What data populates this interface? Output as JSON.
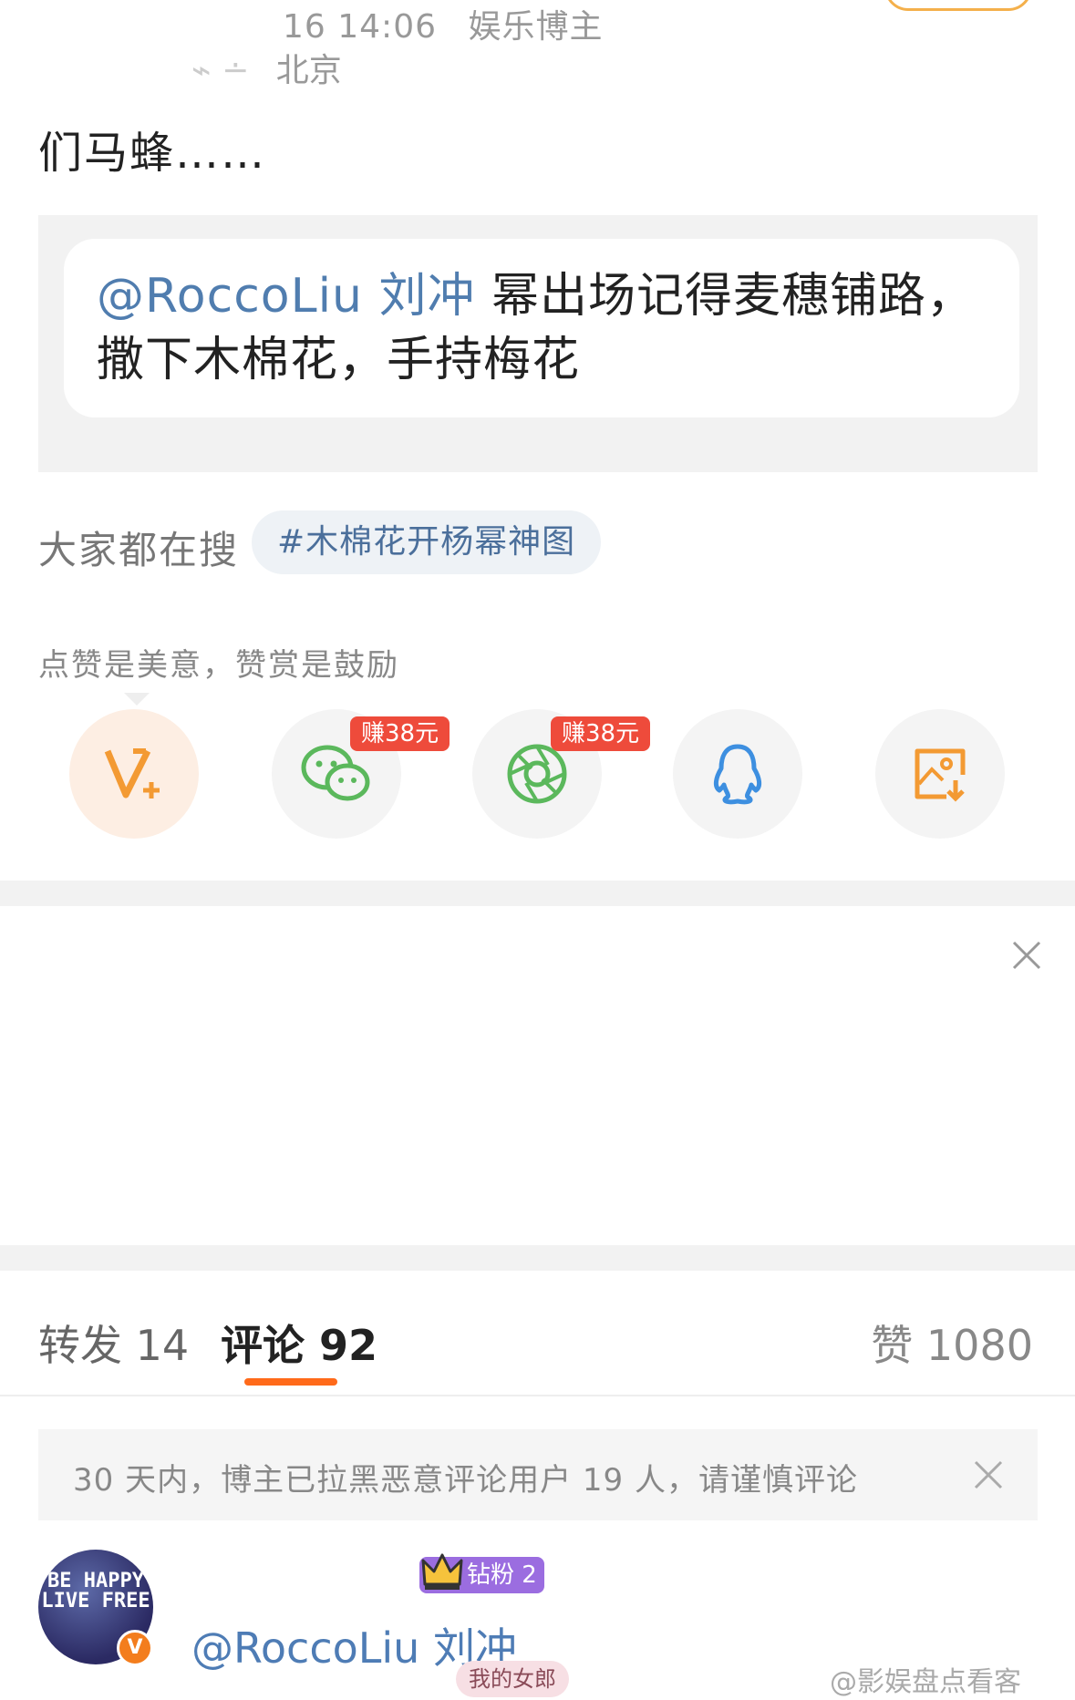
{
  "post": {
    "time": "16 14:06",
    "source": "娱乐博主",
    "location": "北京",
    "text": "们马蜂……"
  },
  "quote": {
    "mention": "@RoccoLiu 刘冲",
    "text_line1": " 幂出场记得麦穗铺路，",
    "text_line2": "撒下木棉花，手持梅花"
  },
  "search": {
    "label": "大家都在搜",
    "tag": "#木棉花开杨幂神图"
  },
  "reward": {
    "hint": "点赞是美意，赞赏是鼓励"
  },
  "share": {
    "items": [
      {
        "icon": "v-plus-icon",
        "badge": ""
      },
      {
        "icon": "wechat-icon",
        "badge": "赚38元"
      },
      {
        "icon": "moments-icon",
        "badge": "赚38元"
      },
      {
        "icon": "qq-icon",
        "badge": ""
      },
      {
        "icon": "save-image-icon",
        "badge": ""
      }
    ]
  },
  "tabs": {
    "repost": "转发 14",
    "comment": "评论 92",
    "like": "赞 1080"
  },
  "notice": {
    "text": "30 天内，博主已拉黑恶意评论用户 19 人，请谨慎评论"
  },
  "comment": {
    "avatar_text": "BE HAPPY LIVE FREE",
    "verified": "V",
    "fan_badge": "钻粉 2",
    "name": "@RoccoLiu 刘冲",
    "sub_badge": "我的女郎"
  },
  "watermark": "@影娱盘点看客",
  "colors": {
    "accent": "#ff6a1a",
    "link": "#507daf",
    "badge_red": "#ee4b3b",
    "wechat_green": "#5bb85c",
    "qq_blue": "#3d8fe0",
    "vip_orange": "#f39a33"
  }
}
